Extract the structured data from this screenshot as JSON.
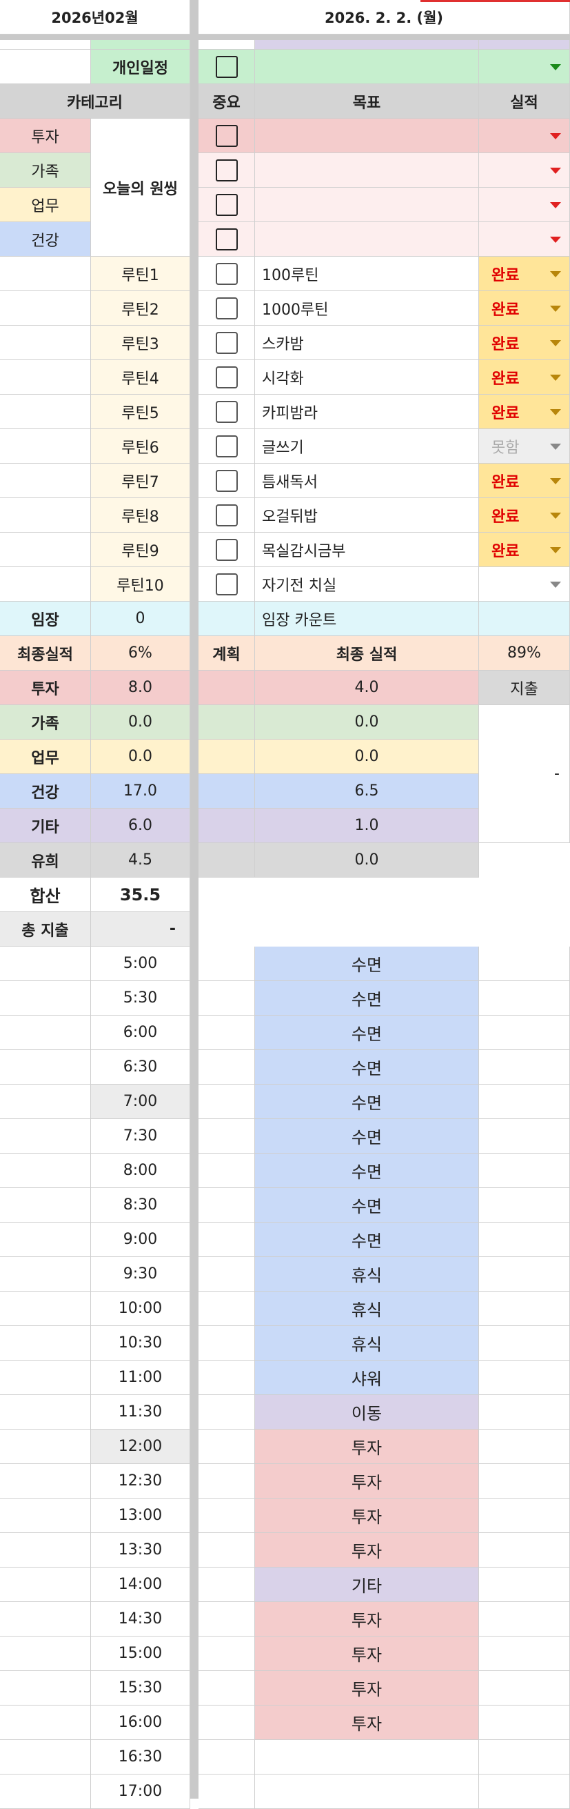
{
  "header": {
    "month": "2026년02월",
    "date": "2026. 2. 2. (월)"
  },
  "personal_label": "개인일정",
  "columns": {
    "category": "카테고리",
    "importance": "중요",
    "goal": "목표",
    "result": "실적"
  },
  "categories": [
    "투자",
    "가족",
    "업무",
    "건강"
  ],
  "today_label": "오늘의 원씽",
  "routines": [
    {
      "label": "루틴1",
      "goal": "100루틴",
      "status": "완료"
    },
    {
      "label": "루틴2",
      "goal": "1000루틴",
      "status": "완료"
    },
    {
      "label": "루틴3",
      "goal": "스카밤",
      "status": "완료"
    },
    {
      "label": "루틴4",
      "goal": "시각화",
      "status": "완료"
    },
    {
      "label": "루틴5",
      "goal": "카피밤라",
      "status": "완료"
    },
    {
      "label": "루틴6",
      "goal": "글쓰기",
      "status": "못함"
    },
    {
      "label": "루틴7",
      "goal": "틈새독서",
      "status": "완료"
    },
    {
      "label": "루틴8",
      "goal": "오걸뒤밥",
      "status": "완료"
    },
    {
      "label": "루틴9",
      "goal": "목실감시금부",
      "status": "완료"
    },
    {
      "label": "루틴10",
      "goal": "자기전 치실",
      "status": ""
    }
  ],
  "imjang": {
    "label": "임장",
    "value": "0",
    "desc": "임장 카운트"
  },
  "final": {
    "label": "최종실적",
    "pct": "6%",
    "plan": "계획",
    "final_label": "최종 실적",
    "final_pct": "89%"
  },
  "expense_label": "지출",
  "expense_value": "-",
  "summary": [
    {
      "label": "투자",
      "value": "8.0",
      "final": "4.0"
    },
    {
      "label": "가족",
      "value": "0.0",
      "final": "0.0"
    },
    {
      "label": "업무",
      "value": "0.0",
      "final": "0.0"
    },
    {
      "label": "건강",
      "value": "17.0",
      "final": "6.5"
    },
    {
      "label": "기타",
      "value": "6.0",
      "final": "1.0"
    },
    {
      "label": "유희",
      "value": "4.5",
      "final": "0.0"
    }
  ],
  "total": {
    "label": "합산",
    "value": "35.5"
  },
  "total_expense": {
    "label": "총 지출",
    "value": "-"
  },
  "schedule": [
    {
      "time": "5:00",
      "activity": "수면"
    },
    {
      "time": "5:30",
      "activity": "수면"
    },
    {
      "time": "6:00",
      "activity": "수면"
    },
    {
      "time": "6:30",
      "activity": "수면"
    },
    {
      "time": "7:00",
      "activity": "수면"
    },
    {
      "time": "7:30",
      "activity": "수면"
    },
    {
      "time": "8:00",
      "activity": "수면"
    },
    {
      "time": "8:30",
      "activity": "수면"
    },
    {
      "time": "9:00",
      "activity": "수면"
    },
    {
      "time": "9:30",
      "activity": "휴식"
    },
    {
      "time": "10:00",
      "activity": "휴식"
    },
    {
      "time": "10:30",
      "activity": "휴식"
    },
    {
      "time": "11:00",
      "activity": "샤워"
    },
    {
      "time": "11:30",
      "activity": "이동"
    },
    {
      "time": "12:00",
      "activity": "투자"
    },
    {
      "time": "12:30",
      "activity": "투자"
    },
    {
      "time": "13:00",
      "activity": "투자"
    },
    {
      "time": "13:30",
      "activity": "투자"
    },
    {
      "time": "14:00",
      "activity": "기타"
    },
    {
      "time": "14:30",
      "activity": "투자"
    },
    {
      "time": "15:00",
      "activity": "투자"
    },
    {
      "time": "15:30",
      "activity": "투자"
    },
    {
      "time": "16:00",
      "activity": "투자"
    },
    {
      "time": "16:30",
      "activity": ""
    },
    {
      "time": "17:00",
      "activity": ""
    }
  ],
  "colors": {
    "investment": "#f4cccc",
    "family": "#d9ead3",
    "work": "#fff2cc",
    "health": "#c9daf8",
    "etc": "#d9d2e9",
    "leisure": "#d9d9d9",
    "personal": "#c6efce",
    "cyan": "#dff6fa",
    "peach": "#fde5d4",
    "routine_bg": "#fff8e6",
    "done_bg": "#ffe599"
  }
}
